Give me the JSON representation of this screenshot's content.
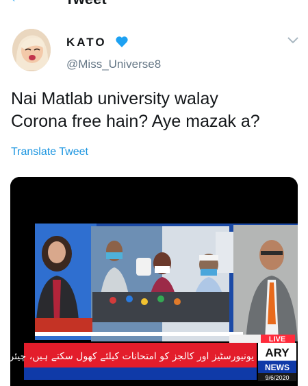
{
  "header": {
    "title": "Tweet"
  },
  "tweet": {
    "display_name": "KATO",
    "handle": "@Miss_Universe8",
    "text_line1": "Nai Matlab university walay",
    "text_line2": "Corona free hain? Aye mazak a?",
    "translate_label": "Translate Tweet"
  },
  "media": {
    "ticker_urdu": "یونیورسٹیز اور کالجز کو امتحانات کیلئے کھول سکتے ہیں، چیئرمین ایچ ای سی",
    "channel_top": "ARY",
    "channel_bottom": "NEWS",
    "live_label": "LIVE",
    "date": "9/6/2020"
  },
  "colors": {
    "link": "#1b95e0",
    "verified": "#1da1f2",
    "ticker_red": "#e31d2b",
    "ticker_blue": "#0f3aa8"
  }
}
